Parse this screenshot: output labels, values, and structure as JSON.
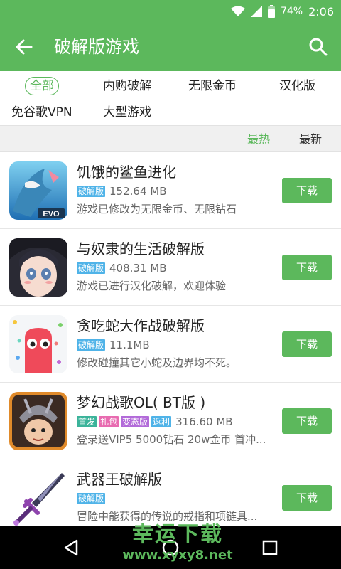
{
  "status_bar": {
    "battery": "74%",
    "time": "2:06"
  },
  "app_bar": {
    "title": "破解版游戏"
  },
  "filters": [
    "全部",
    "内购破解",
    "无限金币",
    "汉化版",
    "免谷歌VPN",
    "大型游戏"
  ],
  "sort_tabs": [
    "最热",
    "最新"
  ],
  "games": [
    {
      "name": "饥饿的鲨鱼进化",
      "badges": [
        "破解版"
      ],
      "size": "152.64 MB",
      "desc": "游戏已修改为无限金币、无限钻石",
      "button": "下载",
      "icon_label": "EVO"
    },
    {
      "name": "与奴隶的生活破解版",
      "badges": [
        "破解版"
      ],
      "size": "408.31 MB",
      "desc": "游戏已进行汉化破解，欢迎体验",
      "button": "下载"
    },
    {
      "name": "贪吃蛇大作战破解版",
      "badges": [
        "破解版"
      ],
      "size": "11.1MB",
      "desc": "修改碰撞其它小蛇及边界均不死。",
      "button": "下载"
    },
    {
      "name": "梦幻战歌OL( BT版 )",
      "badges": [
        "首发",
        "礼包",
        "变态版",
        "返利"
      ],
      "size": "316.60 MB",
      "desc": "登录送VIP5 5000钻石 20w金币 首冲...",
      "button": "下载"
    },
    {
      "name": "武器王破解版",
      "badges": [
        "破解版"
      ],
      "size": "",
      "desc": "冒险中能获得的传说的戒指和项链具...",
      "button": "下载"
    }
  ],
  "watermark": {
    "title": "幸运下载",
    "url": "www.xyxy8.net"
  },
  "colors": {
    "primary": "#5cb85c",
    "badge_blue": "#4fb3e8",
    "badge_green": "#5cb85c",
    "badge_pink": "#e86bb0",
    "badge_purple": "#b26ad9",
    "badge_teal": "#3bb39a"
  }
}
